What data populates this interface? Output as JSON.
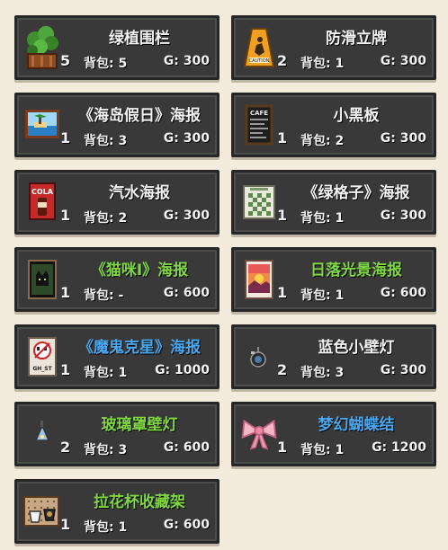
{
  "bag_label": "背包:",
  "gold_label": "G:",
  "items": [
    {
      "name": "绿植围栏",
      "count": "5",
      "bag": "5",
      "gold": "300",
      "name_color": "white",
      "icon": "planter-fence-icon"
    },
    {
      "name": "防滑立牌",
      "count": "2",
      "bag": "1",
      "gold": "300",
      "name_color": "white",
      "icon": "caution-sign-icon"
    },
    {
      "name": "《海岛假日》海报",
      "count": "1",
      "bag": "3",
      "gold": "300",
      "name_color": "white",
      "icon": "island-poster-icon"
    },
    {
      "name": "小黑板",
      "count": "1",
      "bag": "2",
      "gold": "300",
      "name_color": "white",
      "icon": "cafe-chalkboard-icon"
    },
    {
      "name": "汽水海报",
      "count": "1",
      "bag": "2",
      "gold": "300",
      "name_color": "white",
      "icon": "cola-poster-icon"
    },
    {
      "name": "《绿格子》海报",
      "count": "1",
      "bag": "1",
      "gold": "300",
      "name_color": "white",
      "icon": "checker-poster-icon"
    },
    {
      "name": "《猫咪I》海报",
      "count": "1",
      "bag": "-",
      "gold": "600",
      "name_color": "green",
      "icon": "cat-poster-icon"
    },
    {
      "name": "日落光景海报",
      "count": "1",
      "bag": "1",
      "gold": "600",
      "name_color": "green",
      "icon": "sunset-poster-icon"
    },
    {
      "name": "《魔鬼克星》海报",
      "count": "1",
      "bag": "1",
      "gold": "1000",
      "name_color": "blue",
      "icon": "ghost-poster-icon"
    },
    {
      "name": "蓝色小壁灯",
      "count": "2",
      "bag": "3",
      "gold": "300",
      "name_color": "white",
      "icon": "blue-wall-lamp-icon"
    },
    {
      "name": "玻璃罩壁灯",
      "count": "2",
      "bag": "3",
      "gold": "600",
      "name_color": "green",
      "icon": "glass-wall-lamp-icon"
    },
    {
      "name": "梦幻蝴蝶结",
      "count": "1",
      "bag": "1",
      "gold": "1200",
      "name_color": "blue",
      "icon": "pink-bow-icon"
    },
    {
      "name": "拉花杯收藏架",
      "count": "1",
      "bag": "1",
      "gold": "600",
      "name_color": "green",
      "icon": "latte-cup-rack-icon"
    }
  ]
}
